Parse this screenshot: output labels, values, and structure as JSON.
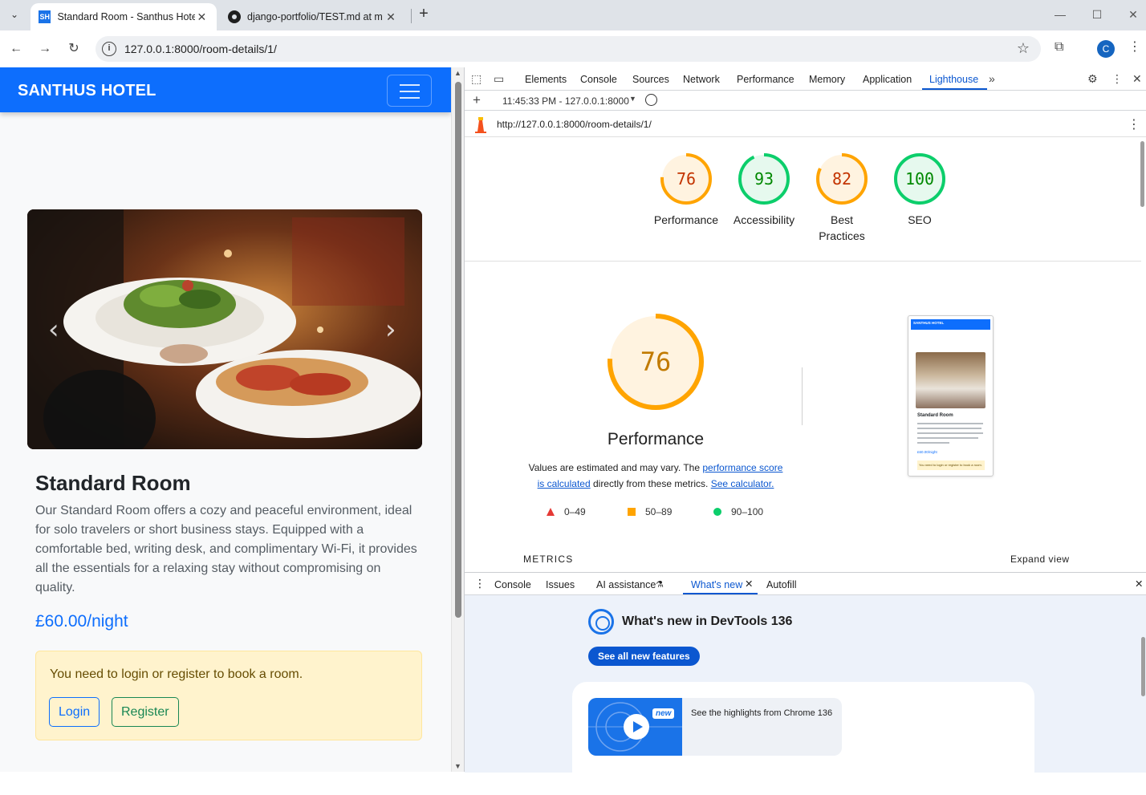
{
  "browser": {
    "tabs": [
      {
        "title": "Standard Room - Santhus Hotel",
        "favicon": "SH",
        "active": true
      },
      {
        "title": "django-portfolio/TEST.md at m",
        "favicon": "github-icon",
        "active": false
      }
    ],
    "url": "127.0.0.1:8000/room-details/1/",
    "profile_initial": "C"
  },
  "site": {
    "brand": "SANTHUS HOTEL",
    "room_title": "Standard Room",
    "room_description": "Our Standard Room offers a cozy and peaceful environment, ideal for solo travelers or short business stays. Equipped with a comfortable bed, writing desk, and complimentary Wi-Fi, it provides all the essentials for a relaxing stay without compromising on quality.",
    "price": "£60.00/night",
    "alert_text": "You need to login or register to book a room.",
    "login_label": "Login",
    "register_label": "Register"
  },
  "devtools": {
    "tabs": [
      "Elements",
      "Console",
      "Sources",
      "Network",
      "Performance",
      "Memory",
      "Application",
      "Lighthouse"
    ],
    "active_tab": "Lighthouse",
    "report_time": "11:45:33 PM - 127.0.0.1:8000",
    "report_url": "http://127.0.0.1:8000/room-details/1/",
    "scores": [
      {
        "score": "76",
        "label": "Performance",
        "color": "#e67700"
      },
      {
        "score": "93",
        "label": "Accessibility",
        "color": "#008800"
      },
      {
        "score": "82",
        "label": "Best Practices",
        "label_line1": "Best",
        "label_line2": "Practices",
        "color": "#c33300"
      },
      {
        "score": "100",
        "label": "SEO",
        "color": "#008800"
      }
    ],
    "performance": {
      "score": "76",
      "title": "Performance",
      "note_prefix": "Values are estimated and may vary. The ",
      "note_link1": "performance score is calculated",
      "note_middle": " directly from these metrics. ",
      "note_link2": "See calculator."
    },
    "legend": [
      {
        "range": "0–49",
        "shape": "triangle",
        "color": "#e53935"
      },
      {
        "range": "50–89",
        "shape": "square",
        "color": "#ffa400"
      },
      {
        "range": "90–100",
        "shape": "circle",
        "color": "#0cce6b"
      }
    ],
    "screenshot": {
      "brand": "SANTHUS HOTEL",
      "title": "Standard Room",
      "price": "£60.00/night",
      "alert": "You need to login or register to book a room."
    },
    "metrics_label": "METRICS",
    "expand_view": "Expand view",
    "drawer": {
      "tabs": [
        "Console",
        "Issues",
        "AI assistance",
        "What's new",
        "Autofill"
      ],
      "active_tab": "What's new",
      "whats_new_title": "What's new in DevTools 136",
      "see_all_label": "See all new features",
      "new_badge": "new",
      "video_text": "See the highlights from Chrome 136"
    }
  }
}
